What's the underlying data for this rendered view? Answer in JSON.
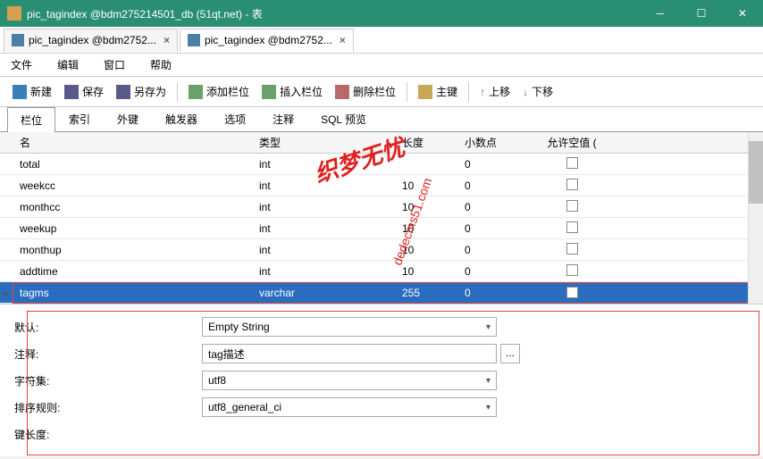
{
  "titlebar": {
    "text": "pic_tagindex @bdm275214501_db (51qt.net) - 表"
  },
  "tabs": [
    {
      "label": "pic_tagindex @bdm2752...",
      "active": false
    },
    {
      "label": "pic_tagindex @bdm2752...",
      "active": true
    }
  ],
  "menu": {
    "file": "文件",
    "edit": "编辑",
    "window": "窗口",
    "help": "帮助"
  },
  "toolbar": {
    "new": "新建",
    "save": "保存",
    "saveas": "另存为",
    "addcol": "添加栏位",
    "insertcol": "插入栏位",
    "delcol": "删除栏位",
    "pkey": "主键",
    "moveup": "上移",
    "movedown": "下移"
  },
  "subtabs": {
    "cols": "栏位",
    "idx": "索引",
    "fk": "外键",
    "trig": "触发器",
    "opt": "选项",
    "cmt": "注释",
    "sql": "SQL 预览"
  },
  "grid": {
    "headers": {
      "name": "名",
      "type": "类型",
      "len": "长度",
      "dec": "小数点",
      "null": "允许空值 ("
    },
    "rows": [
      {
        "name": "total",
        "type": "int",
        "len": "",
        "dec": "0",
        "null": false
      },
      {
        "name": "weekcc",
        "type": "int",
        "len": "10",
        "dec": "0",
        "null": false
      },
      {
        "name": "monthcc",
        "type": "int",
        "len": "10",
        "dec": "0",
        "null": false
      },
      {
        "name": "weekup",
        "type": "int",
        "len": "10",
        "dec": "0",
        "null": false
      },
      {
        "name": "monthup",
        "type": "int",
        "len": "10",
        "dec": "0",
        "null": false
      },
      {
        "name": "addtime",
        "type": "int",
        "len": "10",
        "dec": "0",
        "null": false
      },
      {
        "name": "tagms",
        "type": "varchar",
        "len": "255",
        "dec": "0",
        "null": true
      }
    ]
  },
  "details": {
    "default_label": "默认:",
    "default_value": "Empty String",
    "comment_label": "注释:",
    "comment_value": "tag描述",
    "charset_label": "字符集:",
    "charset_value": "utf8",
    "collate_label": "排序规则:",
    "collate_value": "utf8_general_ci",
    "keylen_label": "键长度:"
  },
  "watermark": {
    "main": "织梦无忧",
    "sub": "dedecms51.com"
  }
}
